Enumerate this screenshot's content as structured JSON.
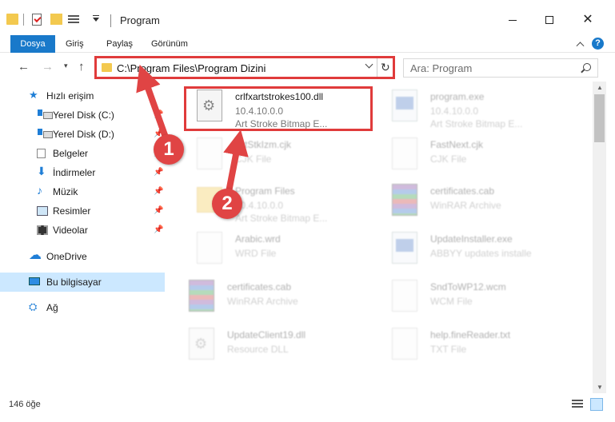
{
  "window": {
    "title": "Program",
    "minimize_label": "—",
    "maximize_label": "",
    "close_label": "✕"
  },
  "ribbon": {
    "tabs": [
      "Dosya",
      "Giriş",
      "Paylaş",
      "Görünüm"
    ],
    "help_label": "?"
  },
  "address": {
    "path": "C:\\Program Files\\Program Dizini",
    "refresh_label": "↻"
  },
  "search": {
    "placeholder": "Ara: Program"
  },
  "nav": {
    "back": "←",
    "forward": "→",
    "recent": "▾",
    "up": "↑"
  },
  "sidebar": {
    "items": [
      {
        "label": "Hızlı erişim",
        "icon": "star-icon",
        "pinned": false
      },
      {
        "label": "Yerel Disk (C:)",
        "icon": "drive-icon",
        "pinned": true
      },
      {
        "label": "Yerel Disk (D:)",
        "icon": "drive-icon",
        "pinned": true
      },
      {
        "label": "Belgeler",
        "icon": "documents-icon",
        "pinned": true
      },
      {
        "label": "İndirmeler",
        "icon": "download-icon",
        "pinned": true
      },
      {
        "label": "Müzik",
        "icon": "music-icon",
        "pinned": true
      },
      {
        "label": "Resimler",
        "icon": "pictures-icon",
        "pinned": true
      },
      {
        "label": "Videolar",
        "icon": "videos-icon",
        "pinned": true
      },
      {
        "label": "OneDrive",
        "icon": "onedrive-icon",
        "pinned": false
      },
      {
        "label": "Bu bilgisayar",
        "icon": "computer-icon",
        "pinned": false
      },
      {
        "label": "Ağ",
        "icon": "network-icon",
        "pinned": false
      }
    ],
    "pin_glyph": "📌"
  },
  "files": [
    {
      "name": "crlfxartstrokes100.dll",
      "line2": "10.4.10.0.0",
      "line3": "Art Stroke Bitmap E...",
      "icon": "dll-icon"
    },
    {
      "name": "program.exe",
      "line2": "10.4.10.0.0",
      "line3": "Art Stroke Bitmap E...",
      "icon": "exe-icon"
    },
    {
      "name": "ArtStkIzm.cjk",
      "line2": "CJK File",
      "line3": "",
      "icon": "file-icon"
    },
    {
      "name": "FastNext.cjk",
      "line2": "CJK File",
      "line3": "",
      "icon": "file-icon"
    },
    {
      "name": "Program Files",
      "line2": "10.4.10.0.0",
      "line3": "Art Stroke Bitmap E...",
      "icon": "folder-icon"
    },
    {
      "name": "certificates.cab",
      "line2": "WinRAR Archive",
      "line3": "",
      "icon": "winrar-icon"
    },
    {
      "name": "Arabic.wrd",
      "line2": "WRD File",
      "line3": "",
      "icon": "file-icon"
    },
    {
      "name": "UpdateInstaller.exe",
      "line2": "ABBYY updates installe",
      "line3": "",
      "icon": "exe-icon"
    },
    {
      "name": "certificates.cab",
      "line2": "WinRAR Archive",
      "line3": "",
      "icon": "winrar-icon"
    },
    {
      "name": "SndToWP12.wcm",
      "line2": "WCM File",
      "line3": "",
      "icon": "file-icon"
    },
    {
      "name": "UpdateClient19.dll",
      "line2": "Resource DLL",
      "line3": "",
      "icon": "dll-icon"
    },
    {
      "name": "help.fineReader.txt",
      "line2": "TXT File",
      "line3": "",
      "icon": "file-icon"
    }
  ],
  "status": {
    "count": "146 öğe"
  },
  "annotations": {
    "badge1": "1",
    "badge2": "2",
    "accent_color": "#e03b3b"
  }
}
